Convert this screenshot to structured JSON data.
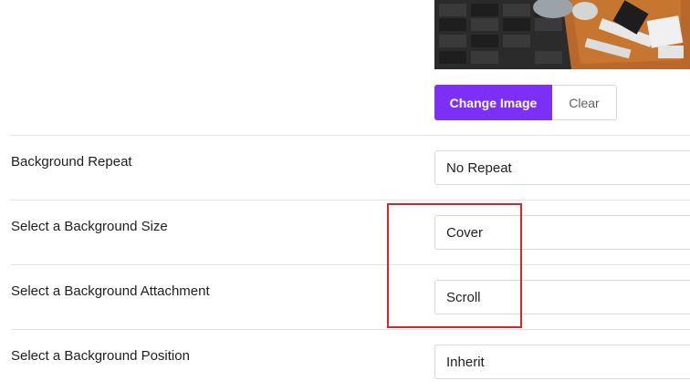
{
  "image_section": {
    "change_button_label": "Change Image",
    "clear_button_label": "Clear"
  },
  "settings": {
    "background_repeat": {
      "label": "Background Repeat",
      "value": "No Repeat"
    },
    "background_size": {
      "label": "Select a Background Size",
      "value": "Cover"
    },
    "background_attachment": {
      "label": "Select a Background Attachment",
      "value": "Scroll"
    },
    "background_position": {
      "label": "Select a Background Position",
      "value": "Inherit"
    }
  },
  "colors": {
    "accent": "#7b2ff7",
    "highlight": "#d9232d"
  }
}
